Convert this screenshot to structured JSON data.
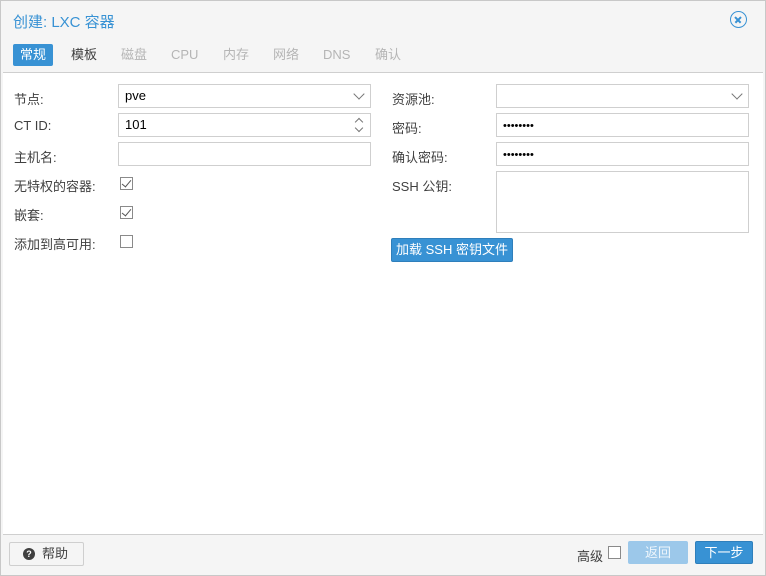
{
  "window": {
    "title": "创建: LXC 容器"
  },
  "tabs": [
    {
      "label": "常规",
      "state": "active"
    },
    {
      "label": "模板",
      "state": "enabled"
    },
    {
      "label": "磁盘",
      "state": "disabled"
    },
    {
      "label": "CPU",
      "state": "disabled"
    },
    {
      "label": "内存",
      "state": "disabled"
    },
    {
      "label": "网络",
      "state": "disabled"
    },
    {
      "label": "DNS",
      "state": "disabled"
    },
    {
      "label": "确认",
      "state": "disabled"
    }
  ],
  "form": {
    "node": {
      "label": "节点:",
      "value": "pve"
    },
    "ctid": {
      "label": "CT ID:",
      "value": "101"
    },
    "hostname": {
      "label": "主机名:",
      "value": ""
    },
    "unprivileged": {
      "label": "无特权的容器:",
      "checked": true
    },
    "nesting": {
      "label": "嵌套:",
      "checked": true
    },
    "ha": {
      "label": "添加到高可用:",
      "checked": false
    },
    "pool": {
      "label": "资源池:",
      "value": ""
    },
    "password": {
      "label": "密码:",
      "masked": "••••••••"
    },
    "confirm_password": {
      "label": "确认密码:",
      "masked": "••••••••"
    },
    "ssh_key": {
      "label": "SSH 公钥:",
      "value": ""
    },
    "load_ssh_button": "加载 SSH 密钥文件"
  },
  "footer": {
    "help_label": "帮助",
    "help_icon_glyph": "?",
    "advanced_label": "高级",
    "advanced_checked": false,
    "back_label": "返回",
    "next_label": "下一步"
  },
  "colors": {
    "accent": "#3892d4",
    "text": "#404040",
    "disabled_text": "#b5b5b5",
    "border": "#cfcfcf"
  }
}
